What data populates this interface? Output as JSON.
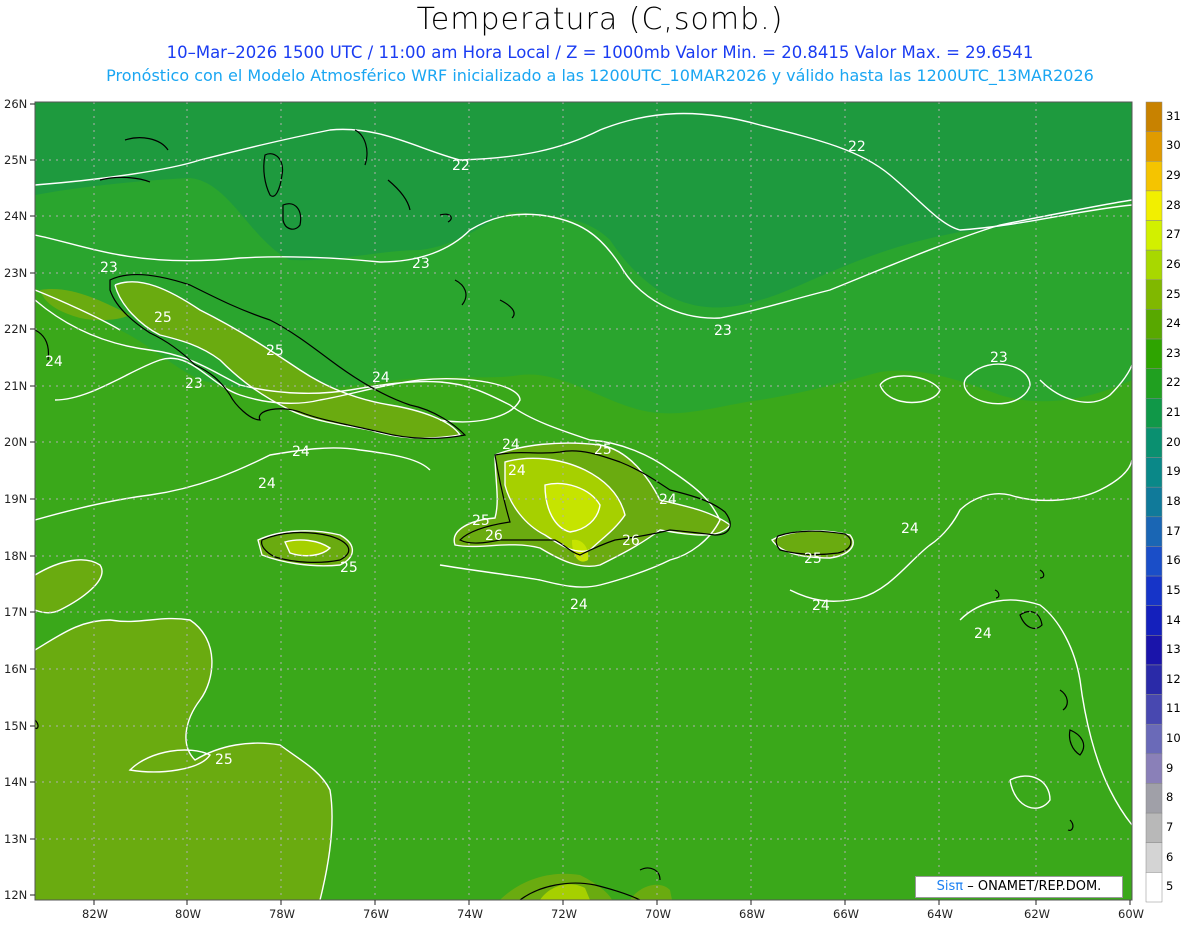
{
  "header": {
    "title": "Temperatura (C,somb.)",
    "subtitle1": "10–Mar–2026 1500 UTC / 11:00 am Hora Local / Z = 1000mb   Valor Min. = 20.8415   Valor Max. = 29.6541",
    "subtitle2": "Pronóstico con el Modelo Atmosférico WRF inicializado a las 1200UTC_10MAR2026 y válido hasta las  1200UTC_13MAR2026"
  },
  "map": {
    "lat_labels": [
      "26N",
      "25N",
      "24N",
      "23N",
      "22N",
      "21N",
      "20N",
      "19N",
      "18N",
      "17N",
      "16N",
      "15N",
      "14N",
      "13N",
      "12N"
    ],
    "lon_labels": [
      "82W",
      "80W",
      "78W",
      "76W",
      "74W",
      "72W",
      "70W",
      "68W",
      "66W",
      "64W",
      "62W",
      "60W"
    ],
    "contour_labels": [
      {
        "text": "22",
        "name": "contour-label-22-north"
      },
      {
        "text": "22",
        "name": "contour-label-22-east"
      },
      {
        "text": "23",
        "name": "contour-label-23-bahamas"
      },
      {
        "text": "23",
        "name": "contour-label-23-west"
      },
      {
        "text": "23",
        "name": "contour-label-23-central"
      },
      {
        "text": "23",
        "name": "contour-label-23-east"
      },
      {
        "text": "23",
        "name": "contour-label-23-cuba-south"
      },
      {
        "text": "24",
        "name": "contour-label-24-yucatan"
      },
      {
        "text": "24",
        "name": "contour-label-24-cuba"
      },
      {
        "text": "24",
        "name": "contour-label-24-caribbean-w"
      },
      {
        "text": "24",
        "name": "contour-label-24-haiti-n"
      },
      {
        "text": "24",
        "name": "contour-label-24-hispaniola-w"
      },
      {
        "text": "24",
        "name": "contour-label-24-dr-east"
      },
      {
        "text": "24",
        "name": "contour-label-24-south-hisp"
      },
      {
        "text": "24",
        "name": "contour-label-24-south-pr"
      },
      {
        "text": "24",
        "name": "contour-label-24-pr-east"
      },
      {
        "text": "24",
        "name": "contour-label-24-lesser-antilles"
      },
      {
        "text": "25",
        "name": "contour-label-25-cuba-w"
      },
      {
        "text": "25",
        "name": "contour-label-25-cuba"
      },
      {
        "text": "25",
        "name": "contour-label-25-hispaniola-n"
      },
      {
        "text": "25",
        "name": "contour-label-25-haiti-sw"
      },
      {
        "text": "25",
        "name": "contour-label-25-jamaica"
      },
      {
        "text": "25",
        "name": "contour-label-25-pr"
      },
      {
        "text": "25",
        "name": "contour-label-25-caribbean-sw"
      },
      {
        "text": "26",
        "name": "contour-label-26-haiti"
      },
      {
        "text": "26",
        "name": "contour-label-26-dr"
      }
    ]
  },
  "colorbar": {
    "labels": [
      "31",
      "30",
      "29",
      "28",
      "27",
      "26",
      "25",
      "24",
      "23",
      "22",
      "21",
      "20",
      "19",
      "18",
      "17",
      "16",
      "15",
      "14",
      "13",
      "12",
      "11",
      "10",
      "9",
      "8",
      "7",
      "6",
      "5"
    ],
    "colors": [
      "#c88200",
      "#e09b00",
      "#f5c400",
      "#f2ef00",
      "#d2f000",
      "#a8d800",
      "#80b800",
      "#58a800",
      "#2ea400",
      "#20a020",
      "#109848",
      "#0a9070",
      "#0a8888",
      "#107a9a",
      "#1a66b4",
      "#1a4ec8",
      "#1634c8",
      "#1420bc",
      "#1a14aa",
      "#2a2aa8",
      "#4848b0",
      "#6a6ab8",
      "#8a80b8",
      "#a0a0a8",
      "#b8b8b8",
      "#d4d4d4",
      "#ffffff"
    ]
  },
  "credit": {
    "brand": "Sisπ",
    "text": "– ONAMET/REP.DOM."
  }
}
